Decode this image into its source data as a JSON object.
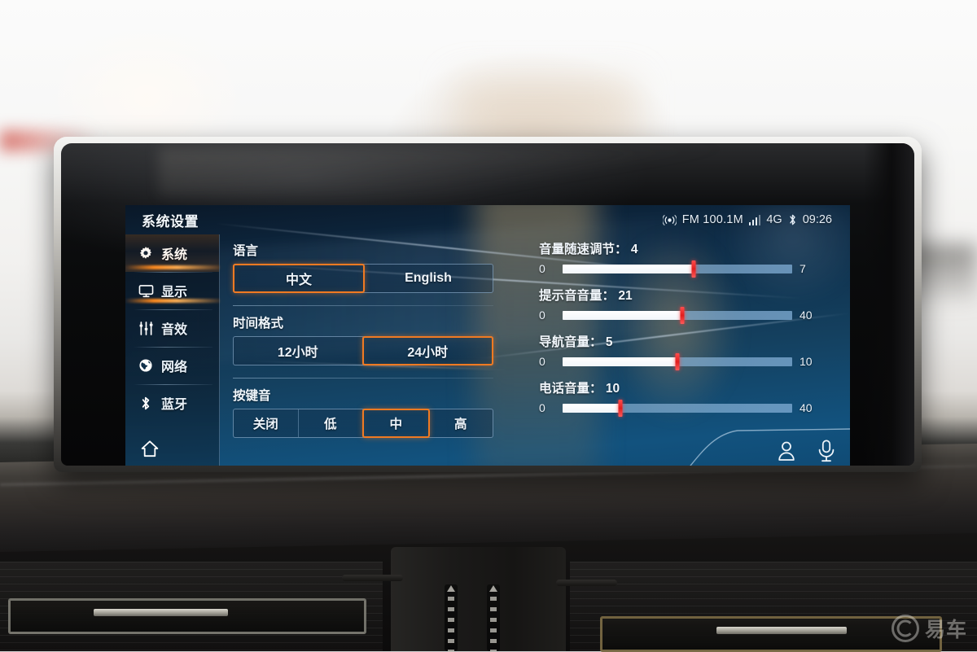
{
  "header": {
    "title": "系统设置",
    "status": {
      "radio_icon": "radio-wave-icon",
      "fm_text": "FM 100.1M",
      "signal_icon": "signal-bars-icon",
      "network": "4G",
      "bluetooth_icon": "bluetooth-icon",
      "clock": "09:26"
    }
  },
  "sidebar": {
    "items": [
      {
        "label": "系统",
        "icon": "gear-icon",
        "selected": true
      },
      {
        "label": "显示",
        "icon": "monitor-icon",
        "selected": false
      },
      {
        "label": "音效",
        "icon": "equalizer-icon",
        "selected": false
      },
      {
        "label": "网络",
        "icon": "globe-icon",
        "selected": false
      },
      {
        "label": "蓝牙",
        "icon": "bluetooth-icon",
        "selected": false
      }
    ],
    "home": {
      "icon": "home-icon",
      "label": ""
    }
  },
  "settings": {
    "language": {
      "label": "语言",
      "options": [
        "中文",
        "English"
      ],
      "selected": "中文"
    },
    "time_format": {
      "label": "时间格式",
      "options": [
        "12小时",
        "24小时"
      ],
      "selected": "24小时"
    },
    "key_tone": {
      "label": "按键音",
      "options": [
        "关闭",
        "低",
        "中",
        "高"
      ],
      "selected": "中"
    }
  },
  "sliders": [
    {
      "label": "音量随速调节：",
      "value": 4,
      "min": 0,
      "max": 7,
      "min_text": "0",
      "max_text": "7",
      "percent": 57
    },
    {
      "label": "提示音音量：",
      "value": 21,
      "min": 0,
      "max": 40,
      "min_text": "0",
      "max_text": "40",
      "percent": 52
    },
    {
      "label": "导航音量：",
      "value": 5,
      "min": 0,
      "max": 10,
      "min_text": "0",
      "max_text": "10",
      "percent": 50
    },
    {
      "label": "电话音量：",
      "value": 10,
      "min": 0,
      "max": 40,
      "min_text": "0",
      "max_text": "40",
      "percent": 25
    }
  ],
  "bottom_actions": [
    {
      "icon": "user-profile-icon"
    },
    {
      "icon": "microphone-icon"
    }
  ],
  "watermark": {
    "text": "易车",
    "logo": "yiche-logo-icon"
  },
  "colors": {
    "accent_orange": "#f07a22",
    "slider_thumb_red": "#e01e1e",
    "screen_blue_top": "#0a1828",
    "screen_blue_bottom": "#0f4a74",
    "text_primary": "#eef4fa"
  }
}
